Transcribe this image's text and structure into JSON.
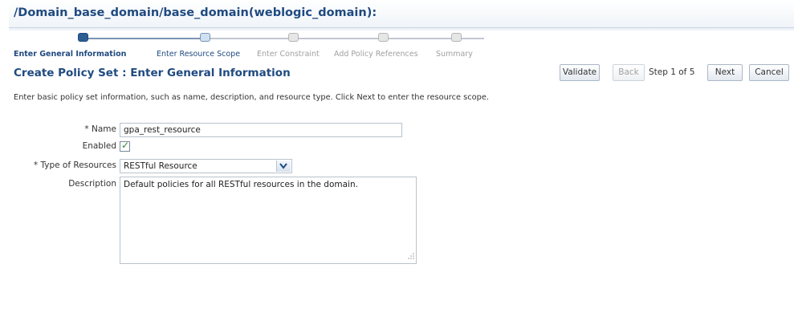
{
  "page": {
    "title": "/Domain_base_domain/base_domain(weblogic_domain):"
  },
  "train": {
    "steps": [
      {
        "label": "Enter General Information",
        "state": "current"
      },
      {
        "label": "Enter Resource Scope",
        "state": "next"
      },
      {
        "label": "Enter Constraint",
        "state": "todo"
      },
      {
        "label": "Add Policy References",
        "state": "todo"
      },
      {
        "label": "Summary",
        "state": "todo"
      }
    ]
  },
  "section": {
    "title": "Create Policy Set : Enter General Information"
  },
  "toolbar": {
    "validate_label": "Validate",
    "back_label": "Back",
    "step_label": "Step 1 of 5",
    "next_label": "Next",
    "cancel_label": "Cancel"
  },
  "instruction": "Enter basic policy set information, such as name, description, and resource type. Click Next to enter the resource scope.",
  "form": {
    "name": {
      "label": "Name",
      "required_mark": "* ",
      "value": "gpa_rest_resource"
    },
    "enabled": {
      "label": "Enabled",
      "checked": true
    },
    "type_of_resources": {
      "label": "Type of Resources",
      "required_mark": "* ",
      "value": "RESTful Resource"
    },
    "description": {
      "label": "Description",
      "value": "Default policies for all RESTful resources in the domain."
    }
  },
  "colors": {
    "accent": "#1f4a80",
    "disabled_text": "#a0a0a0",
    "check": "#2a8a2a"
  }
}
